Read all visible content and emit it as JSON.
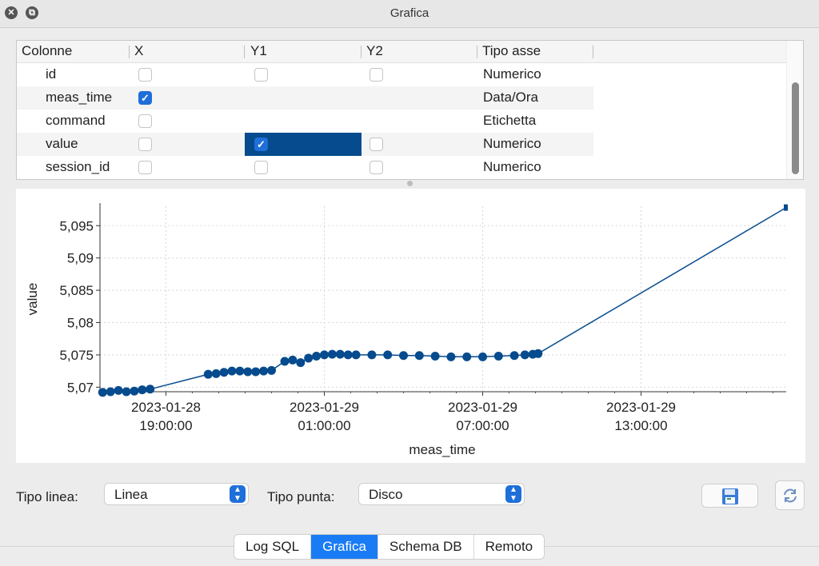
{
  "window": {
    "title": "Grafica"
  },
  "table": {
    "headers": [
      "Colonne",
      "X",
      "Y1",
      "Y2",
      "Tipo asse"
    ],
    "rows": [
      {
        "name": "id",
        "x": false,
        "y1": false,
        "y2": false,
        "axis": "Numerico",
        "has_y": true
      },
      {
        "name": "meas_time",
        "x": true,
        "y1": null,
        "y2": null,
        "axis": "Data/Ora",
        "has_y": false
      },
      {
        "name": "command",
        "x": false,
        "y1": null,
        "y2": null,
        "axis": "Etichetta",
        "has_y": false
      },
      {
        "name": "value",
        "x": false,
        "y1": true,
        "y2": false,
        "axis": "Numerico",
        "has_y": true
      },
      {
        "name": "session_id",
        "x": false,
        "y1": false,
        "y2": false,
        "axis": "Numerico",
        "has_y": true
      }
    ]
  },
  "chart_data": {
    "type": "line",
    "title": "",
    "xlabel": "meas_time",
    "ylabel": "value",
    "x_ticks": [
      [
        "2023-01-28",
        "19:00:00"
      ],
      [
        "2023-01-29",
        "01:00:00"
      ],
      [
        "2023-01-29",
        "07:00:00"
      ],
      [
        "2023-01-29",
        "13:00:00"
      ]
    ],
    "y_ticks": [
      "5,07",
      "5,075",
      "5,08",
      "5,085",
      "5,09",
      "5,095"
    ],
    "y_tick_values": [
      5.07,
      5.075,
      5.08,
      5.085,
      5.09,
      5.095
    ],
    "ylim": [
      5.0693,
      5.098
    ],
    "xlim_hours": [
      16.5,
      42.5
    ],
    "x_tick_hours": [
      19,
      25,
      31,
      37
    ],
    "line_color": "#064b8e",
    "grid": true,
    "series": [
      {
        "name": "",
        "x_hours": [
          16.6,
          16.9,
          17.2,
          17.5,
          17.8,
          18.1,
          18.4,
          20.6,
          20.9,
          21.2,
          21.5,
          21.8,
          22.1,
          22.4,
          22.7,
          23.0,
          23.5,
          23.8,
          24.1,
          24.4,
          24.7,
          25.0,
          25.3,
          25.6,
          25.9,
          26.2,
          26.8,
          27.4,
          28.0,
          28.6,
          29.2,
          29.8,
          30.4,
          31.0,
          31.6,
          32.2,
          32.6,
          32.9,
          33.1,
          42.5
        ],
        "values": [
          5.0692,
          5.0693,
          5.0695,
          5.0693,
          5.0694,
          5.0696,
          5.0697,
          5.072,
          5.0721,
          5.0723,
          5.0725,
          5.0725,
          5.0724,
          5.0724,
          5.0725,
          5.0726,
          5.074,
          5.0742,
          5.0738,
          5.0745,
          5.0748,
          5.075,
          5.0751,
          5.0751,
          5.075,
          5.075,
          5.075,
          5.075,
          5.0749,
          5.0749,
          5.0748,
          5.0747,
          5.0747,
          5.0747,
          5.0748,
          5.0749,
          5.075,
          5.0751,
          5.0752,
          5.0978
        ]
      }
    ]
  },
  "controls": {
    "line_type_label": "Tipo linea:",
    "line_type_value": "Linea",
    "point_type_label": "Tipo punta:",
    "point_type_value": "Disco",
    "save_icon": "save-image-icon",
    "refresh_icon": "refresh-icon"
  },
  "tabs": [
    {
      "label": "Log SQL",
      "active": false
    },
    {
      "label": "Grafica",
      "active": true
    },
    {
      "label": "Schema DB",
      "active": false
    },
    {
      "label": "Remoto",
      "active": false
    }
  ]
}
